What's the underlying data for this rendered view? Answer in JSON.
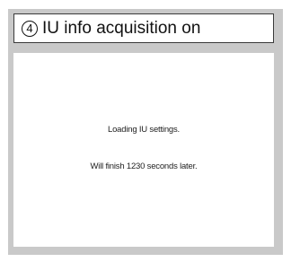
{
  "header": {
    "step_number": "4",
    "title": "IU info acquisition on"
  },
  "content": {
    "status_line": "Loading IU settings.",
    "eta_line": "Will finish 1230 seconds later."
  }
}
